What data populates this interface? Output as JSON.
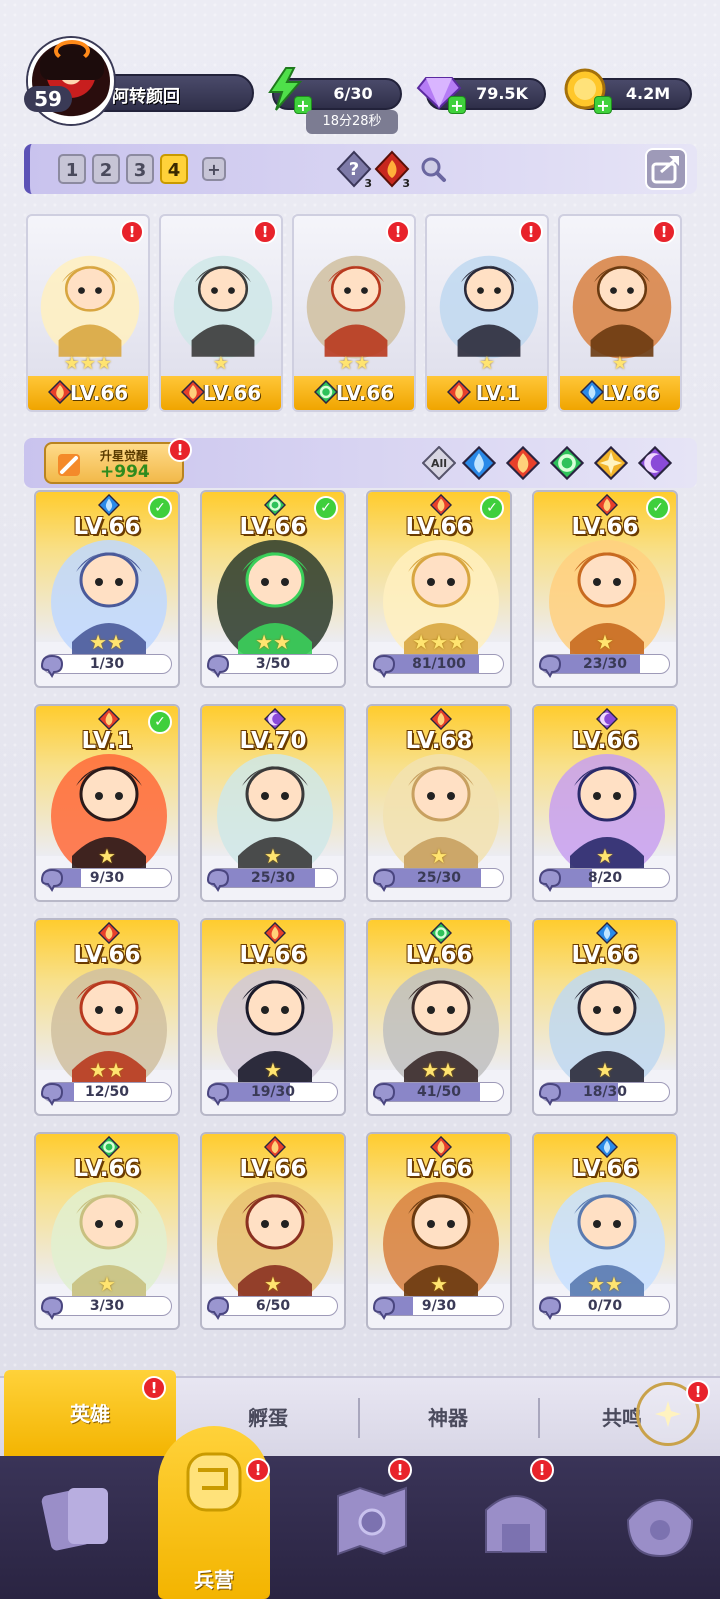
{
  "player": {
    "level": "59",
    "name": "阿转颜回"
  },
  "resources": {
    "energy": "6/30",
    "energy_timer": "18分28秒",
    "gems": "79.5K",
    "gold": "4.2M"
  },
  "teams": {
    "tabs": [
      "1",
      "2",
      "3",
      "4"
    ],
    "active_index": 3,
    "add_label": "+",
    "hint_counts": [
      "3",
      "3"
    ]
  },
  "team_slots": [
    {
      "level": "LV.66",
      "stars": "★★★",
      "element": "fire",
      "alert": "!"
    },
    {
      "level": "LV.66",
      "stars": "★",
      "element": "fire",
      "alert": "!"
    },
    {
      "level": "LV.66",
      "stars": "★★",
      "element": "wind",
      "alert": "!"
    },
    {
      "level": "LV.1",
      "stars": "★",
      "element": "fire",
      "alert": "!"
    },
    {
      "level": "LV.66",
      "stars": "★",
      "element": "water",
      "alert": "!"
    }
  ],
  "filter": {
    "awaken_label": "升星觉醒",
    "awaken_value": "+994",
    "all_label": "All",
    "chips": [
      "water",
      "fire",
      "wind",
      "light",
      "dark"
    ]
  },
  "heroes": [
    {
      "level": "LV.66",
      "element": "water",
      "checked": true,
      "stars": "★★",
      "progress": "1/30",
      "ratio": 0.03
    },
    {
      "level": "LV.66",
      "element": "wind",
      "checked": true,
      "stars": "★★",
      "progress": "3/50",
      "ratio": 0.06
    },
    {
      "level": "LV.66",
      "element": "fire",
      "checked": true,
      "stars": "★★★",
      "progress": "81/100",
      "ratio": 0.81
    },
    {
      "level": "LV.66",
      "element": "fire",
      "checked": true,
      "stars": "★",
      "progress": "23/30",
      "ratio": 0.77
    },
    {
      "level": "LV.1",
      "element": "fire",
      "checked": true,
      "stars": "★",
      "progress": "9/30",
      "ratio": 0.3
    },
    {
      "level": "LV.70",
      "element": "dark",
      "checked": false,
      "stars": "★",
      "progress": "25/30",
      "ratio": 0.83
    },
    {
      "level": "LV.68",
      "element": "fire",
      "checked": false,
      "stars": "★",
      "progress": "25/30",
      "ratio": 0.83
    },
    {
      "level": "LV.66",
      "element": "dark",
      "checked": false,
      "stars": "★",
      "progress": "8/20",
      "ratio": 0.4
    },
    {
      "level": "LV.66",
      "element": "fire",
      "checked": false,
      "stars": "★★",
      "progress": "12/50",
      "ratio": 0.24
    },
    {
      "level": "LV.66",
      "element": "fire",
      "checked": false,
      "stars": "★",
      "progress": "19/30",
      "ratio": 0.63
    },
    {
      "level": "LV.66",
      "element": "wind",
      "checked": false,
      "stars": "★★",
      "progress": "41/50",
      "ratio": 0.82
    },
    {
      "level": "LV.66",
      "element": "water",
      "checked": false,
      "stars": "★",
      "progress": "18/30",
      "ratio": 0.6
    },
    {
      "level": "LV.66",
      "element": "wind",
      "checked": false,
      "stars": "★",
      "progress": "3/30",
      "ratio": 0.1
    },
    {
      "level": "LV.66",
      "element": "fire",
      "checked": false,
      "stars": "★",
      "progress": "6/50",
      "ratio": 0.12
    },
    {
      "level": "LV.66",
      "element": "fire",
      "checked": false,
      "stars": "★",
      "progress": "9/30",
      "ratio": 0.3
    },
    {
      "level": "LV.66",
      "element": "water",
      "checked": false,
      "stars": "★★",
      "progress": "0/70",
      "ratio": 0.0
    }
  ],
  "subtabs": [
    "英雄",
    "孵蛋",
    "神器",
    "共鸣"
  ],
  "nav": {
    "active_label": "兵营"
  },
  "colors": {
    "fire": "#e8402a",
    "water": "#2a8ae8",
    "wind": "#2ec25a",
    "light": "#f2b42a",
    "dark": "#8a4ad8"
  }
}
